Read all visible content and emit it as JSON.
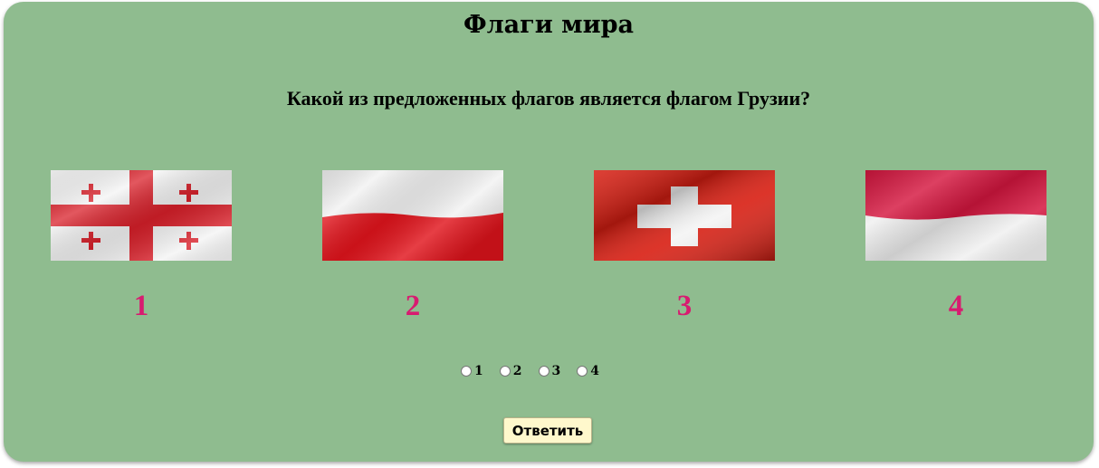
{
  "quiz": {
    "title": "Флаги мира",
    "question": "Какой из предложенных флагов является флагом Грузии?",
    "flags": [
      {
        "number": "1",
        "icon": "georgia-flag"
      },
      {
        "number": "2",
        "icon": "poland-flag"
      },
      {
        "number": "3",
        "icon": "switzerland-flag"
      },
      {
        "number": "4",
        "icon": "monaco-flag"
      }
    ],
    "options": [
      {
        "label": "1",
        "checked": false
      },
      {
        "label": "2",
        "checked": false
      },
      {
        "label": "3",
        "checked": false
      },
      {
        "label": "4",
        "checked": false
      }
    ],
    "submit_label": "Ответить"
  },
  "colors": {
    "panel_background": "#8fbc8f",
    "number_color": "#d81b70",
    "button_background": "#fff8cc"
  }
}
